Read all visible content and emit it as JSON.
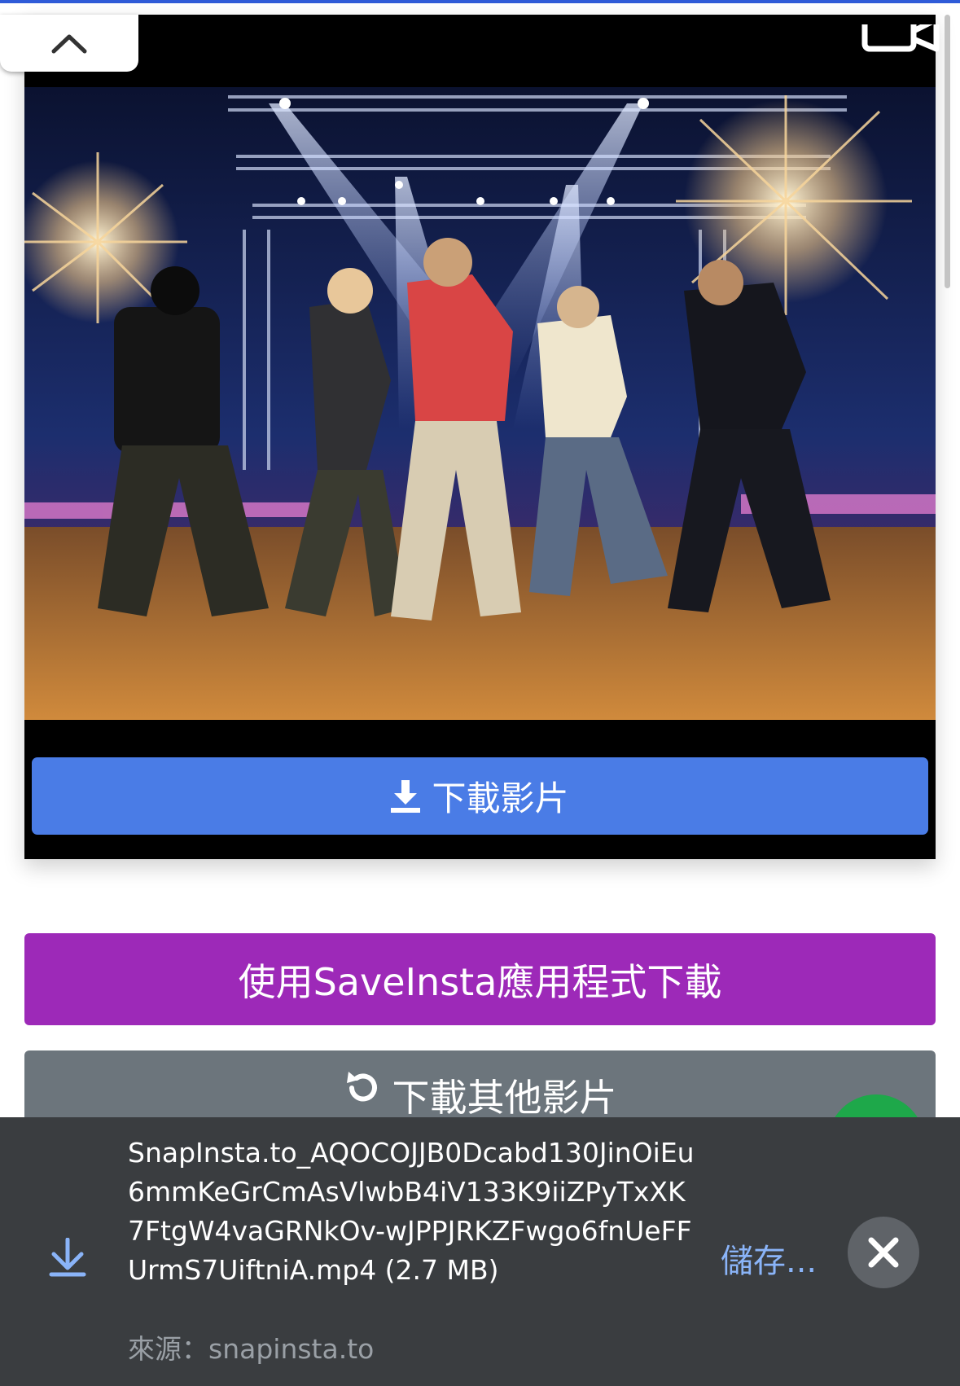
{
  "buttons": {
    "download_video": "下載影片",
    "download_with_app": "使用SaveInsta應用程式下載",
    "download_other": "下載其他影片"
  },
  "download_bar": {
    "filename": "SnapInsta.to_AQOCOJJB0Dcabd130JinOiEu6mmKeGrCmAsVlwbB4iV133K9iiZPyTxXK7FtgW4vaGRNkOv-wJPPJRKZFwgo6fnUeFFUrmS7UiftniA.mp4 (2.7 MB)",
    "source": "來源：snapinsta.to",
    "save_label": "儲存..."
  },
  "icons": {
    "scroll_top": "chevron-up-icon",
    "download": "download-icon",
    "refresh": "refresh-icon",
    "close": "close-icon",
    "camera": "camera-icon"
  },
  "colors": {
    "download_button": "#4a7ce6",
    "app_button": "#9d29b8",
    "other_button": "#6c757c",
    "download_bar_bg": "#3a3d40",
    "save_link": "#8ab4f8"
  }
}
